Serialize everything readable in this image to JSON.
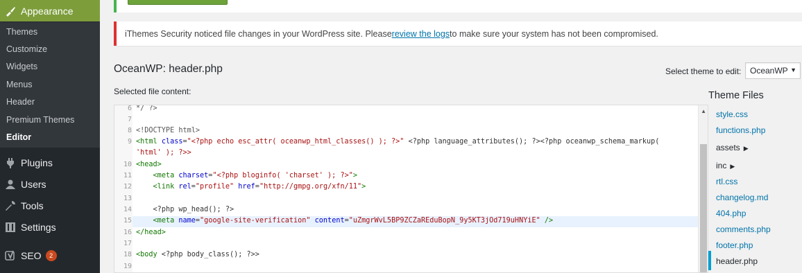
{
  "sidebar": {
    "appearance": {
      "label": "Appearance",
      "icon": "paintbrush-icon"
    },
    "submenu": [
      {
        "label": "Themes"
      },
      {
        "label": "Customize"
      },
      {
        "label": "Widgets"
      },
      {
        "label": "Menus"
      },
      {
        "label": "Header"
      },
      {
        "label": "Premium Themes"
      },
      {
        "label": "Editor",
        "current": true
      }
    ],
    "menu": [
      {
        "label": "Plugins",
        "icon": "plugin-icon"
      },
      {
        "label": "Users",
        "icon": "users-icon"
      },
      {
        "label": "Tools",
        "icon": "wrench-icon"
      },
      {
        "label": "Settings",
        "icon": "settings-icon"
      },
      {
        "label": "SEO",
        "icon": "yoast-icon",
        "badge": "2"
      }
    ]
  },
  "notice": {
    "prefix": "iThemes Security noticed file changes in your WordPress site. Please ",
    "link": "review the logs ",
    "suffix": "to make sure your system has not been compromised."
  },
  "page": {
    "title": "OceanWP: header.php",
    "selected_label": "Selected file content:",
    "select_theme_label": "Select theme to edit:",
    "select_theme_value": "OceanWP"
  },
  "editor": {
    "line_numbers": [
      "6",
      "7",
      "8",
      "9",
      "",
      "10",
      "11",
      "12",
      "13",
      "14",
      "15",
      "16",
      "17",
      "18",
      "19"
    ],
    "lines": {
      "l6": "*/ ?>",
      "l8": "<!DOCTYPE html>",
      "l9_tag": "<html",
      "l9_attr": "class",
      "l9_val": "\"<?php echo esc_attr( oceanwp_html_classes() ); ?>\"",
      "l9_rest": " <?php language_attributes(); ?><?php oceanwp_schema_markup(",
      "l9b": "'html' ); ?>>",
      "l10": "<head>",
      "l11_tag": "<meta",
      "l11_attr": "charset",
      "l11_val": "\"<?php bloginfo( 'charset' ); ?>\"",
      "l11_end": ">",
      "l12_tag": "<link",
      "l12_attr1": "rel",
      "l12_val1": "\"profile\"",
      "l12_attr2": "href",
      "l12_val2": "\"http://gmpg.org/xfn/11\"",
      "l12_end": ">",
      "l14": "<?php wp_head(); ?>",
      "l15_tag": "<meta",
      "l15_attr1": "name",
      "l15_val1": "\"google-site-verification\"",
      "l15_attr2": "content",
      "l15_val2": "\"uZmgrWvL5BP9ZCZaREduBopN_9y5KT3jOd719uHNYiE\"",
      "l15_end": " />",
      "l16": "</head>",
      "l18_tag": "<body",
      "l18_rest": " <?php body_class(); ?>>"
    },
    "highlighted_line": "15"
  },
  "theme_files": {
    "title": "Theme Files",
    "items": [
      {
        "label": "style.css",
        "type": "file"
      },
      {
        "label": "functions.php",
        "type": "file"
      },
      {
        "label": "assets",
        "type": "dir"
      },
      {
        "label": "inc",
        "type": "dir"
      },
      {
        "label": "rtl.css",
        "type": "file"
      },
      {
        "label": "changelog.md",
        "type": "file"
      },
      {
        "label": "404.php",
        "type": "file"
      },
      {
        "label": "comments.php",
        "type": "file"
      },
      {
        "label": "footer.php",
        "type": "file"
      },
      {
        "label": "header.php",
        "type": "file",
        "current": true
      }
    ]
  },
  "colors": {
    "sidebar": "#23282d",
    "accent": "#7d9d3b",
    "link": "#0073aa",
    "notice_error": "#dc3232"
  }
}
